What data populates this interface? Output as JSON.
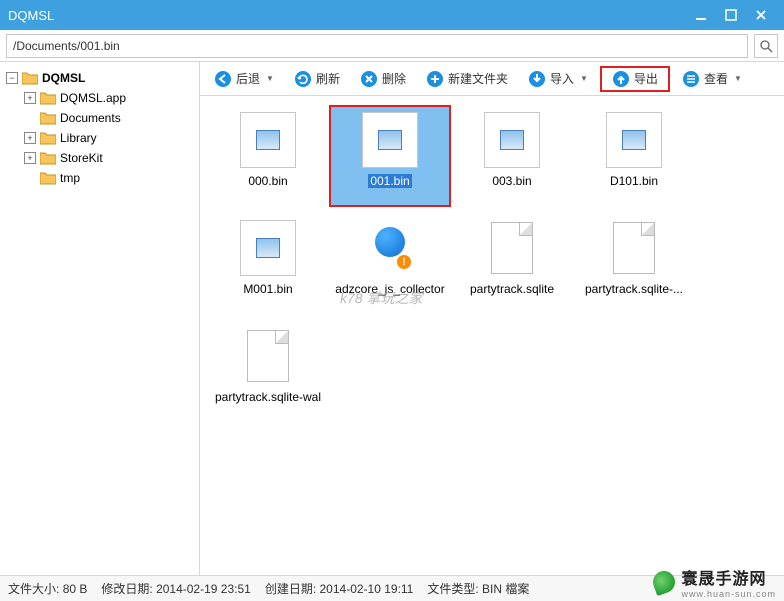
{
  "window": {
    "title": "DQMSL"
  },
  "path": "/Documents/001.bin",
  "tree": {
    "root": {
      "label": "DQMSL",
      "expanded": true
    },
    "children": [
      {
        "label": "DQMSL.app",
        "expandable": true
      },
      {
        "label": "Documents",
        "expandable": false,
        "selected": true
      },
      {
        "label": "Library",
        "expandable": true
      },
      {
        "label": "StoreKit",
        "expandable": true
      },
      {
        "label": "tmp",
        "expandable": false
      }
    ]
  },
  "toolbar": {
    "back": "后退",
    "refresh": "刷新",
    "delete": "删除",
    "newfolder": "新建文件夹",
    "import": "导入",
    "export": "导出",
    "view": "查看"
  },
  "toolbar_icons": {
    "back": "#1b8fe0",
    "refresh": "#1b8fe0",
    "delete": "#1b8fe0",
    "newfolder": "#1b8fe0",
    "import": "#1b8fe0",
    "export": "#1b8fe0",
    "view": "#1b8fe0"
  },
  "files": [
    {
      "name": "000.bin",
      "kind": "image-thumb"
    },
    {
      "name": "001.bin",
      "kind": "image-thumb",
      "selected": true,
      "highlight": true
    },
    {
      "name": "003.bin",
      "kind": "image-thumb"
    },
    {
      "name": "D101.bin",
      "kind": "image-thumb"
    },
    {
      "name": "M001.bin",
      "kind": "image-thumb"
    },
    {
      "name": "adzcore_js_collector",
      "kind": "qq"
    },
    {
      "name": "partytrack.sqlite",
      "kind": "doc"
    },
    {
      "name": "partytrack.sqlite-...",
      "kind": "doc"
    },
    {
      "name": "partytrack.sqlite-wal",
      "kind": "doc"
    }
  ],
  "status": {
    "size_label": "文件大小:",
    "size_value": "80 B",
    "mtime_label": "修改日期:",
    "mtime_value": "2014-02-19 23:51",
    "ctime_label": "创建日期:",
    "ctime_value": "2014-02-10 19:11",
    "type_label": "文件类型:",
    "type_value": "BIN 檔案"
  },
  "watermark": {
    "main": "寰晟手游网",
    "sub": "www.huan-sun.com"
  },
  "overlay_watermark": "k78 掌玩之家"
}
